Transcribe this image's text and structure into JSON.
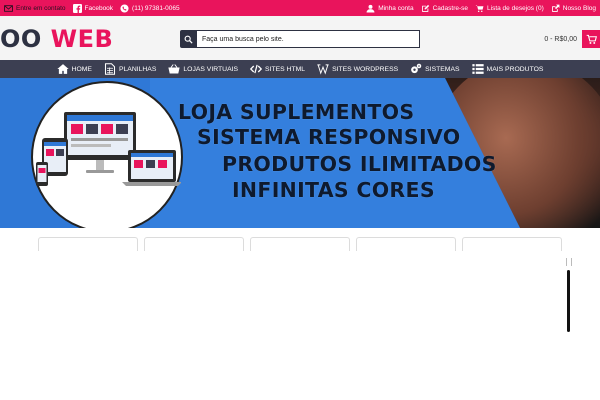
{
  "topbar": {
    "contact": "Entre em contato",
    "facebook": "Facebook",
    "phone": "(11) 97381-0065",
    "account": "Minha conta",
    "register": "Cadastre-se",
    "wishlist": "Lista de desejos (0)",
    "blog": "Nosso Blog"
  },
  "header": {
    "logo_part1": "OO",
    "logo_part2": " WEB",
    "search_placeholder": "Faça uma busca pelo site.",
    "cart_total": "0 - R$0,00"
  },
  "nav": {
    "items": [
      {
        "label": "HOME",
        "icon": "home-icon"
      },
      {
        "label": "PLANILHAS",
        "icon": "spreadsheet-icon"
      },
      {
        "label": "LOJAS VIRTUAIS",
        "icon": "basket-icon"
      },
      {
        "label": "SITES HTML",
        "icon": "code-icon"
      },
      {
        "label": "SITES WORDPRESS",
        "icon": "wordpress-icon"
      },
      {
        "label": "SISTEMAS",
        "icon": "gears-icon"
      },
      {
        "label": "MAIS PRODUTOS",
        "icon": "list-icon"
      }
    ]
  },
  "banner": {
    "line1": "LOJA SUPLEMENTOS",
    "line2": "SISTEMA RESPONSIVO",
    "line3": "PRODUTOS ILIMITADOS",
    "line4": "INFINITAS CORES"
  },
  "colors": {
    "brand_pink": "#e9145c",
    "nav_dark": "#3c3f52",
    "banner_blue": "#2f78d6"
  }
}
